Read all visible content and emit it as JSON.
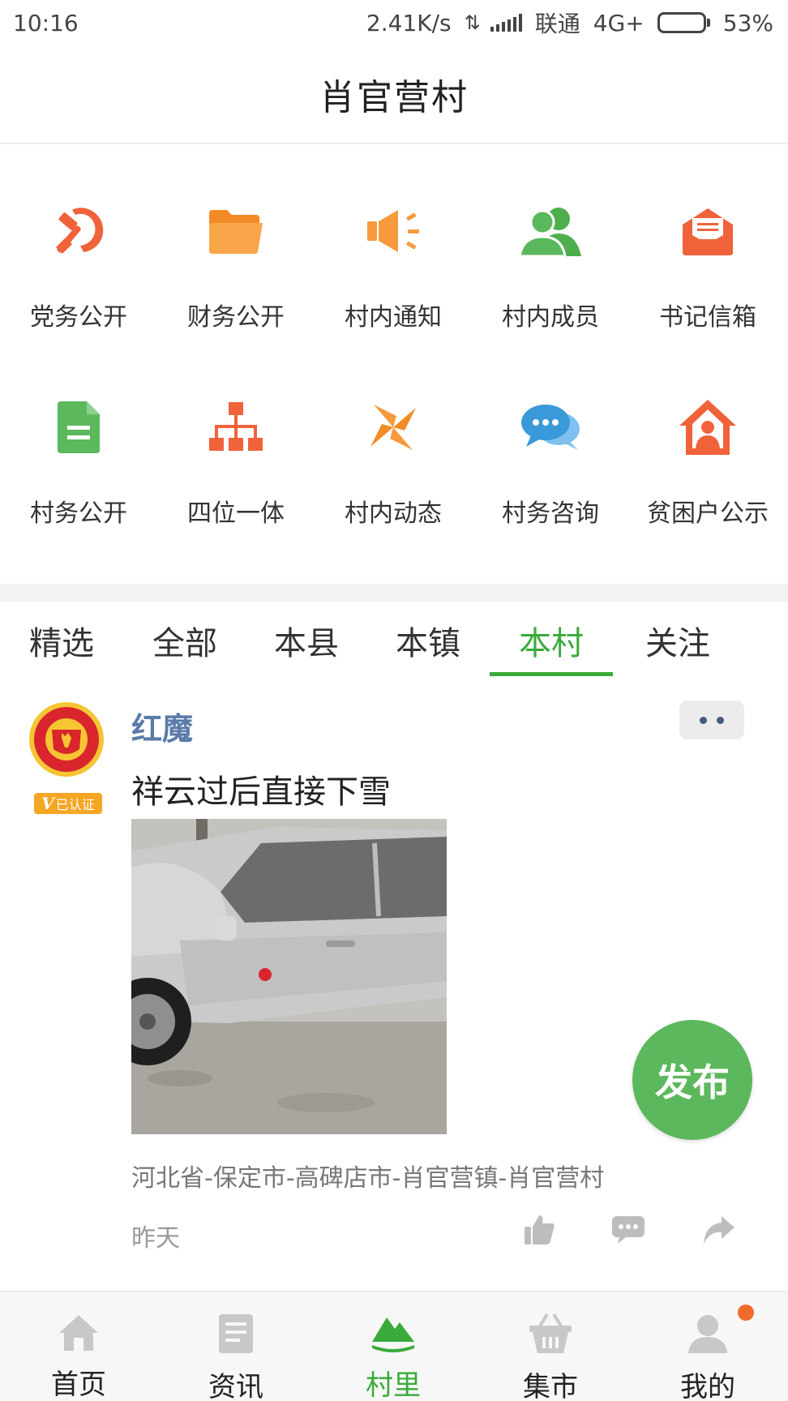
{
  "status": {
    "time": "10:16",
    "speed": "2.41K/s",
    "carrier": "联通",
    "network": "4G+",
    "battery_text": "53%",
    "battery_level": 0.53
  },
  "title": "肖官营村",
  "grid": [
    {
      "label": "党务公开",
      "icon": "party-emblem-icon",
      "color": "#f0623a"
    },
    {
      "label": "财务公开",
      "icon": "folder-icon",
      "color": "#f79a3e"
    },
    {
      "label": "村内通知",
      "icon": "megaphone-icon",
      "color": "#f79a3e"
    },
    {
      "label": "村内成员",
      "icon": "members-icon",
      "color": "#5cb85c"
    },
    {
      "label": "书记信箱",
      "icon": "mailbox-icon",
      "color": "#f0623a"
    },
    {
      "label": "村务公开",
      "icon": "document-icon",
      "color": "#5cb85c"
    },
    {
      "label": "四位一体",
      "icon": "org-chart-icon",
      "color": "#f0623a"
    },
    {
      "label": "村内动态",
      "icon": "pinwheel-icon",
      "color": "#f79a3e"
    },
    {
      "label": "村务咨询",
      "icon": "chat-bubbles-icon",
      "color": "#3a9ad9"
    },
    {
      "label": "贫困户公示",
      "icon": "house-person-icon",
      "color": "#f0623a"
    }
  ],
  "tabs": [
    "精选",
    "全部",
    "本县",
    "本镇",
    "本村",
    "关注"
  ],
  "active_tab": "本村",
  "post": {
    "author": "红魔",
    "verified_label": "已认证",
    "text": "祥云过后直接下雪",
    "location": "河北省-保定市-高碑店市-肖官营镇-肖官营村",
    "time": "昨天"
  },
  "fab_label": "发布",
  "nav": [
    {
      "label": "首页",
      "icon": "home-icon"
    },
    {
      "label": "资讯",
      "icon": "news-icon"
    },
    {
      "label": "村里",
      "icon": "village-icon"
    },
    {
      "label": "集市",
      "icon": "basket-icon"
    },
    {
      "label": "我的",
      "icon": "profile-icon"
    }
  ],
  "active_nav": "村里",
  "colors": {
    "accent_green": "#3aaa3a",
    "fab_green": "#5cb85c",
    "author_blue": "#5a7ba8",
    "badge_orange": "#f26b2a"
  }
}
